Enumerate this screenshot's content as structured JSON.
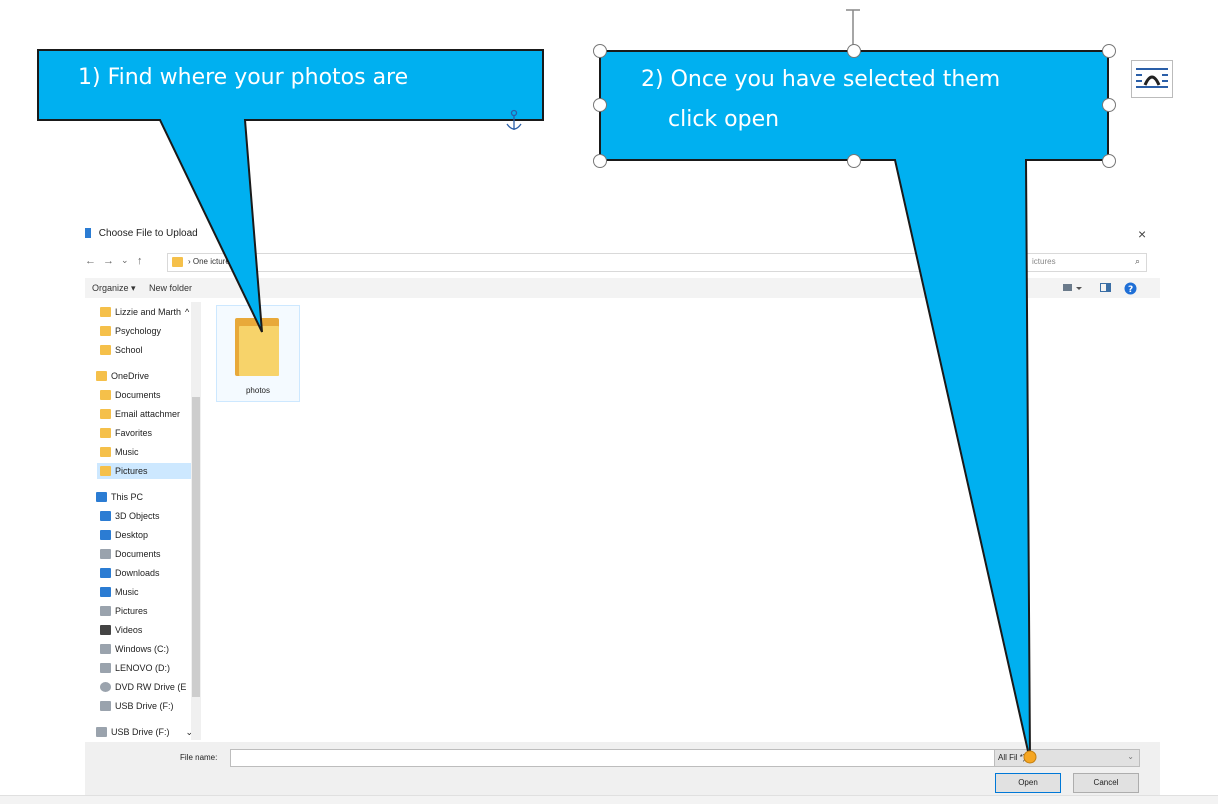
{
  "dialog": {
    "title": "Choose File to Upload",
    "close_glyph": "×",
    "nav": {
      "back": "←",
      "forward": "→",
      "recent": "⌄",
      "up": "↑"
    },
    "address_crumbs": "›  One          ictures",
    "search_text": "ictures",
    "search_glyph": "⌕",
    "toolbar": {
      "organize": "Organize ▾",
      "new_folder": "New folder"
    },
    "sidebar_items": [
      {
        "label": "Lizzie and Marth",
        "icon": "folder-icon",
        "extra": "^"
      },
      {
        "label": "Psychology",
        "icon": "folder-icon"
      },
      {
        "label": "School",
        "icon": "folder-icon"
      },
      {
        "label": "OneDrive",
        "icon": "folder-icon"
      },
      {
        "label": "Documents",
        "icon": "folder-icon"
      },
      {
        "label": "Email attachmer",
        "icon": "folder-icon"
      },
      {
        "label": "Favorites",
        "icon": "folder-icon"
      },
      {
        "label": "Music",
        "icon": "folder-icon"
      },
      {
        "label": "Pictures",
        "icon": "folder-icon",
        "selected": true
      },
      {
        "label": "This PC",
        "icon": "computer-icon"
      },
      {
        "label": "3D Objects",
        "icon": "cube-icon"
      },
      {
        "label": "Desktop",
        "icon": "desktop-icon"
      },
      {
        "label": "Documents",
        "icon": "document-icon"
      },
      {
        "label": "Downloads",
        "icon": "download-icon"
      },
      {
        "label": "Music",
        "icon": "music-icon"
      },
      {
        "label": "Pictures",
        "icon": "pictures-icon"
      },
      {
        "label": "Videos",
        "icon": "video-icon"
      },
      {
        "label": "Windows (C:)",
        "icon": "drive-icon"
      },
      {
        "label": "LENOVO (D:)",
        "icon": "drive-icon"
      },
      {
        "label": "DVD RW Drive (E",
        "icon": "dvd-icon"
      },
      {
        "label": "USB Drive (F:)",
        "icon": "usb-icon"
      },
      {
        "label": "USB Drive (F:)",
        "icon": "usb-icon",
        "extra": "⌄"
      }
    ],
    "content": {
      "folder_label": "photos"
    },
    "bottom": {
      "file_name_label": "File name:",
      "file_name_value": "",
      "file_type": "All Fil     *)",
      "open_label": "Open",
      "cancel_label": "Cancel"
    }
  },
  "callouts": {
    "first": "1) Find where your photos are",
    "second_line1": "2) Once you have selected them",
    "second_line2": "click open"
  },
  "colors": {
    "callout_fill": "#00b0f0",
    "accent": "#0078d7",
    "folder": "#f5c04a",
    "selection": "#cde8ff"
  }
}
